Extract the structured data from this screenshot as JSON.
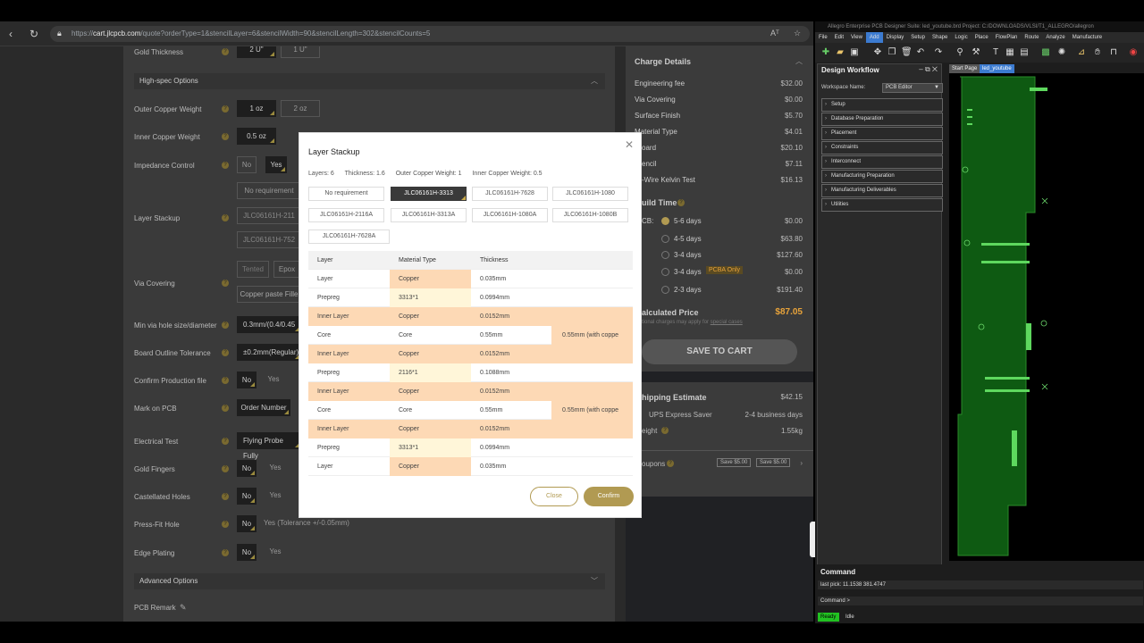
{
  "browser": {
    "url_prefix": "https://",
    "url_host": "cart.jlcpcb.com",
    "url_rest": "/quote?orderType=1&stencilLayer=6&stencilWidth=90&stencilLength=302&stencilCounts=5",
    "reader_label": "Aᵀ"
  },
  "form": {
    "gold_thickness": {
      "label": "Gold Thickness",
      "options": [
        "2 U\"",
        "1 U\""
      ]
    },
    "high_spec_header": "High-spec Options",
    "outer_copper": {
      "label": "Outer Copper Weight",
      "options": [
        "1 oz",
        "2 oz"
      ]
    },
    "inner_copper": {
      "label": "Inner Copper Weight",
      "options": [
        "0.5 oz"
      ]
    },
    "impedance": {
      "label": "Impedance Control",
      "options": [
        "No",
        "Yes"
      ],
      "sub": "No requirement"
    },
    "layer_stackup": {
      "label": "Layer Stackup",
      "values": [
        "JLC06161H-211",
        "JLC06161H-752"
      ]
    },
    "via_covering": {
      "label": "Via Covering",
      "options": [
        "Tented",
        "Epox"
      ],
      "value": "Copper paste Fille"
    },
    "min_via": {
      "label": "Min via hole size/diameter",
      "value": "0.3mm/(0.4/0.45"
    },
    "board_outline": {
      "label": "Board Outline Tolerance",
      "value": "±0.2mm(Regular)"
    },
    "confirm_file": {
      "label": "Confirm Production file",
      "options": [
        "No",
        "Yes"
      ]
    },
    "mark_on_pcb": {
      "label": "Mark on PCB",
      "value": "Order Number"
    },
    "electrical_test": {
      "label": "Electrical Test",
      "value": "Flying Probe Fully"
    },
    "gold_fingers": {
      "label": "Gold Fingers",
      "options": [
        "No",
        "Yes"
      ]
    },
    "castellated": {
      "label": "Castellated Holes",
      "options": [
        "No",
        "Yes"
      ]
    },
    "press_fit": {
      "label": "Press-Fit Hole",
      "options": [
        "No",
        "Yes (Tolerance +/-0.05mm)"
      ]
    },
    "edge_plating": {
      "label": "Edge Plating",
      "options": [
        "No",
        "Yes"
      ]
    },
    "advanced_header": "Advanced Options",
    "pcb_remark": "PCB Remark"
  },
  "charge": {
    "title": "Charge Details",
    "items": [
      {
        "label": "Engineering fee",
        "value": "$32.00"
      },
      {
        "label": "Via Covering",
        "value": "$0.00"
      },
      {
        "label": "Surface Finish",
        "value": "$5.70"
      },
      {
        "label": "Material Type",
        "value": "$4.01"
      },
      {
        "label": "oard",
        "value": "$20.10"
      },
      {
        "label": "encil",
        "value": "$7.11"
      },
      {
        "label": "-Wire Kelvin Test",
        "value": "$16.13"
      }
    ],
    "build_time_label": "uild Time",
    "build_prefix": "CB:",
    "build_options": [
      {
        "label": "5-6 days",
        "value": "$0.00",
        "checked": true
      },
      {
        "label": "4-5 days",
        "value": "$63.80",
        "checked": false
      },
      {
        "label": "3-4 days",
        "value": "$127.60",
        "checked": false
      },
      {
        "label": "3-4 days",
        "value": "$0.00",
        "checked": false,
        "badge": "PCBA Only"
      },
      {
        "label": "2-3 days",
        "value": "$191.40",
        "checked": false
      }
    ],
    "calc_label": "alculated Price",
    "calc_value": "$87.05",
    "calc_note": "tional charges may apply for",
    "calc_note_link": "special cases",
    "save_button": "SAVE TO CART"
  },
  "shipping": {
    "title": "hipping Estimate",
    "price": "$42.15",
    "method": "UPS Express Saver",
    "days": "2-4 business days",
    "weight_label": "eight",
    "weight": "1.55kg",
    "coupons_label": "oupons",
    "coupon1": "Save $5.00",
    "coupon2": "Save $5.00"
  },
  "modal": {
    "title": "Layer Stackup",
    "specs": [
      "Layers: 6",
      "Thickness: 1.6",
      "Outer Copper Weight: 1",
      "Inner Copper Weight: 0.5"
    ],
    "options": [
      "No requirement",
      "JLC06161H-3313",
      "JLC06161H-7628",
      "JLC06161H-1080",
      "JLC06161H-2116A",
      "JLC06161H-3313A",
      "JLC06161H-1080A",
      "JLC06161H-1080B",
      "JLC06161H-7628A"
    ],
    "headers": [
      "Layer",
      "Material Type",
      "Thickness"
    ],
    "rows": [
      {
        "layer": "Layer",
        "material": "Copper",
        "thickness": "0.035mm"
      },
      {
        "layer": "Prepreg",
        "material": "3313*1",
        "thickness": "0.0994mm"
      },
      {
        "layer": "Inner Layer",
        "material": "Copper",
        "thickness": "0.0152mm"
      },
      {
        "layer": "Core",
        "material": "Core",
        "thickness": "0.55mm"
      },
      {
        "layer": "Inner Layer",
        "material": "Copper",
        "thickness": "0.0152mm"
      },
      {
        "layer": "Prepreg",
        "material": "2116*1",
        "thickness": "0.1088mm"
      },
      {
        "layer": "Inner Layer",
        "material": "Copper",
        "thickness": "0.0152mm"
      },
      {
        "layer": "Core",
        "material": "Core",
        "thickness": "0.55mm"
      },
      {
        "layer": "Inner Layer",
        "material": "Copper",
        "thickness": "0.0152mm"
      },
      {
        "layer": "Prepreg",
        "material": "3313*1",
        "thickness": "0.0994mm"
      },
      {
        "layer": "Layer",
        "material": "Copper",
        "thickness": "0.035mm"
      }
    ],
    "core_note_1": "0.55mm (with coppe",
    "core_note_2": "0.55mm (with coppe",
    "close_button": "Close",
    "confirm_button": "Confirm"
  },
  "allegro": {
    "title": "Allegro Enterprise PCB Designer Suite: led_youtube.brd  Project: C:/DOWNLOADS/VLSI/T1_ALLEGRO/allegron",
    "menu": [
      "File",
      "Edit",
      "View",
      "Add",
      "Display",
      "Setup",
      "Shape",
      "Logic",
      "Place",
      "FlowPlan",
      "Route",
      "Analyze",
      "Manufacture"
    ],
    "workflow_title": "Design Workflow",
    "workspace_label": "Workspace Name:",
    "workspace_value": "PCB Editor",
    "workflow_items": [
      "Setup",
      "Database Preparation",
      "Placement",
      "Constraints",
      "Interconnect",
      "Manufacturing Preparation",
      "Manufacturing Deliverables",
      "Utilities"
    ],
    "tabs": [
      "Start Page",
      "led_youtube"
    ],
    "command_title": "Command",
    "last_pick": "last pick: 11.1538 381.4747",
    "command_prompt": "Command >",
    "status_ready": "Ready",
    "status_idle": "Idle"
  },
  "colors": {
    "accent_gold": "#b19a52",
    "price_orange": "#e8a33a",
    "cell_orange": "#fdd9b5",
    "allegro_green": "#22c222"
  }
}
